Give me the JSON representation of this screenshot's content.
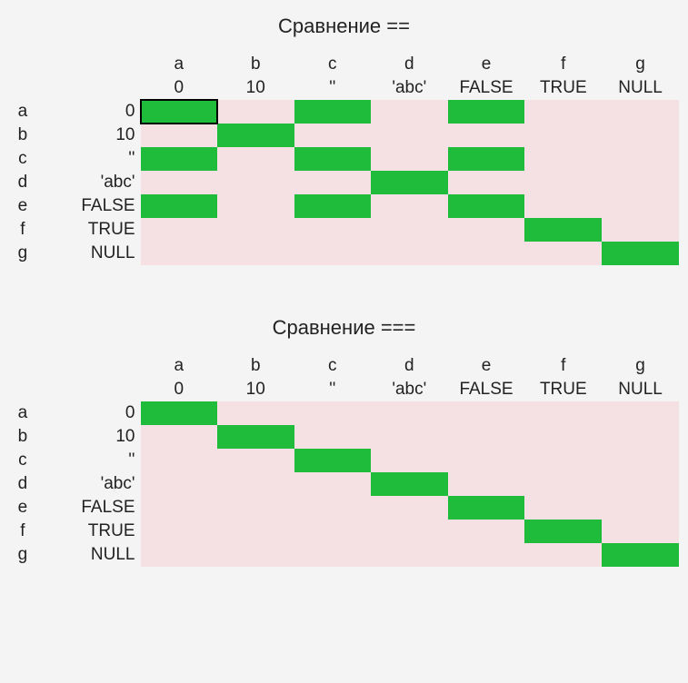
{
  "vars": [
    {
      "letter": "a",
      "label": "0"
    },
    {
      "letter": "b",
      "label": "10"
    },
    {
      "letter": "c",
      "label": "''"
    },
    {
      "letter": "d",
      "label": "'abc'"
    },
    {
      "letter": "e",
      "label": "FALSE"
    },
    {
      "letter": "f",
      "label": "TRUE"
    },
    {
      "letter": "g",
      "label": "NULL"
    }
  ],
  "colors": {
    "true": "#1fbb3a",
    "false": "#f5e1e4"
  },
  "chart_data": [
    {
      "type": "heatmap",
      "title": "Сравнение ==",
      "row_labels": [
        "a",
        "b",
        "c",
        "d",
        "e",
        "f",
        "g"
      ],
      "row_values": [
        "0",
        "10",
        "''",
        "'abc'",
        "FALSE",
        "TRUE",
        "NULL"
      ],
      "col_labels": [
        "a",
        "b",
        "c",
        "d",
        "e",
        "f",
        "g"
      ],
      "col_values": [
        "0",
        "10",
        "''",
        "'abc'",
        "FALSE",
        "TRUE",
        "NULL"
      ],
      "matrix": [
        [
          1,
          0,
          1,
          0,
          1,
          0,
          0
        ],
        [
          0,
          1,
          0,
          0,
          0,
          0,
          0
        ],
        [
          1,
          0,
          1,
          0,
          1,
          0,
          0
        ],
        [
          0,
          0,
          0,
          1,
          0,
          0,
          0
        ],
        [
          1,
          0,
          1,
          0,
          1,
          0,
          0
        ],
        [
          0,
          0,
          0,
          0,
          0,
          1,
          0
        ],
        [
          0,
          0,
          0,
          0,
          0,
          0,
          1
        ]
      ],
      "selected_cell": [
        0,
        0
      ]
    },
    {
      "type": "heatmap",
      "title": "Сравнение ===",
      "row_labels": [
        "a",
        "b",
        "c",
        "d",
        "e",
        "f",
        "g"
      ],
      "row_values": [
        "0",
        "10",
        "''",
        "'abc'",
        "FALSE",
        "TRUE",
        "NULL"
      ],
      "col_labels": [
        "a",
        "b",
        "c",
        "d",
        "e",
        "f",
        "g"
      ],
      "col_values": [
        "0",
        "10",
        "''",
        "'abc'",
        "FALSE",
        "TRUE",
        "NULL"
      ],
      "matrix": [
        [
          1,
          0,
          0,
          0,
          0,
          0,
          0
        ],
        [
          0,
          1,
          0,
          0,
          0,
          0,
          0
        ],
        [
          0,
          0,
          1,
          0,
          0,
          0,
          0
        ],
        [
          0,
          0,
          0,
          1,
          0,
          0,
          0
        ],
        [
          0,
          0,
          0,
          0,
          1,
          0,
          0
        ],
        [
          0,
          0,
          0,
          0,
          0,
          1,
          0
        ],
        [
          0,
          0,
          0,
          0,
          0,
          0,
          1
        ]
      ],
      "selected_cell": null
    }
  ]
}
